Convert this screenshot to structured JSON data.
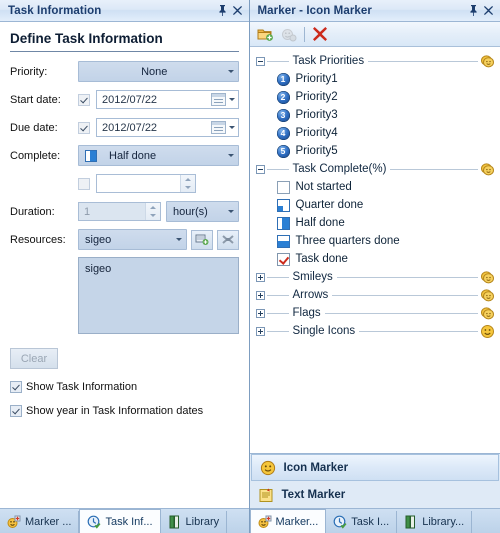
{
  "left_panel": {
    "title": "Task Information",
    "pin_icon": "pin-icon",
    "close_icon": "close-icon",
    "heading": "Define Task Information",
    "fields": {
      "priority": {
        "label": "Priority:",
        "value": "None"
      },
      "start_date": {
        "label": "Start date:",
        "value": "2012/07/22",
        "checked": true
      },
      "due_date": {
        "label": "Due date:",
        "value": "2012/07/22",
        "checked": true
      },
      "complete": {
        "label": "Complete:",
        "value": "Half done",
        "icon": "half-done-icon"
      },
      "percent": {
        "label": "",
        "value": "",
        "checked": false
      },
      "duration": {
        "label": "Duration:",
        "value": "1",
        "unit": "hour(s)"
      },
      "resources": {
        "label": "Resources:",
        "value": "sigeo"
      }
    },
    "resources_list": [
      "sigeo"
    ],
    "clear_button": "Clear",
    "checkboxes": [
      {
        "label": "Show Task Information",
        "checked": true
      },
      {
        "label": "Show year in Task Information dates",
        "checked": true
      }
    ],
    "add_resource_icon": "add-resource-icon",
    "remove_resource_icon": "remove-resource-icon"
  },
  "right_panel": {
    "title": "Marker - Icon Marker",
    "pin_icon": "pin-icon",
    "close_icon": "close-icon",
    "toolbar": [
      {
        "name": "new-folder-icon",
        "label": "New Folder"
      },
      {
        "name": "edit-marker-icon",
        "label": "Edit Marker"
      },
      {
        "name": "delete-icon",
        "label": "Delete"
      }
    ],
    "tree": [
      {
        "group": "Task Priorities",
        "expanded": true,
        "icon": "coins-icon",
        "items": [
          {
            "label": "Priority1",
            "icon": "number-1-icon"
          },
          {
            "label": "Priority2",
            "icon": "number-2-icon"
          },
          {
            "label": "Priority3",
            "icon": "number-3-icon"
          },
          {
            "label": "Priority4",
            "icon": "number-4-icon"
          },
          {
            "label": "Priority5",
            "icon": "number-5-icon"
          }
        ]
      },
      {
        "group": "Task Complete(%)",
        "expanded": true,
        "icon": "coins-icon",
        "items": [
          {
            "label": "Not started",
            "icon": "progress-0-icon"
          },
          {
            "label": "Quarter done",
            "icon": "progress-25-icon"
          },
          {
            "label": "Half done",
            "icon": "progress-50-icon"
          },
          {
            "label": "Three quarters done",
            "icon": "progress-75-icon"
          },
          {
            "label": "Task done",
            "icon": "progress-100-icon"
          }
        ]
      },
      {
        "group": "Smileys",
        "expanded": false,
        "icon": "coins-icon",
        "items": []
      },
      {
        "group": "Arrows",
        "expanded": false,
        "icon": "coins-icon",
        "items": []
      },
      {
        "group": "Flags",
        "expanded": false,
        "icon": "coins-icon",
        "items": []
      },
      {
        "group": "Single Icons",
        "expanded": false,
        "icon": "smiley-icon",
        "items": []
      }
    ],
    "marker_types": [
      {
        "label": "Icon Marker",
        "icon": "smiley-icon",
        "selected": true
      },
      {
        "label": "Text Marker",
        "icon": "note-icon",
        "selected": false
      }
    ],
    "tabs": [
      {
        "label": "Marker...",
        "icon": "marker-icon",
        "active": true
      },
      {
        "label": "Task I...",
        "icon": "task-info-icon",
        "active": false
      },
      {
        "label": "Library...",
        "icon": "library-icon",
        "active": false
      }
    ]
  },
  "left_tabs": [
    {
      "label": "Marker ...",
      "icon": "marker-icon",
      "active": false
    },
    {
      "label": "Task Inf...",
      "icon": "task-info-icon",
      "active": true
    },
    {
      "label": "Library",
      "icon": "library-icon",
      "active": false
    }
  ],
  "colors": {
    "title_text": "#1c3d6e",
    "accent_blue": "#2a7fd4",
    "delete_red": "#cc2b1d",
    "coin_gold": "#f2c33c"
  }
}
